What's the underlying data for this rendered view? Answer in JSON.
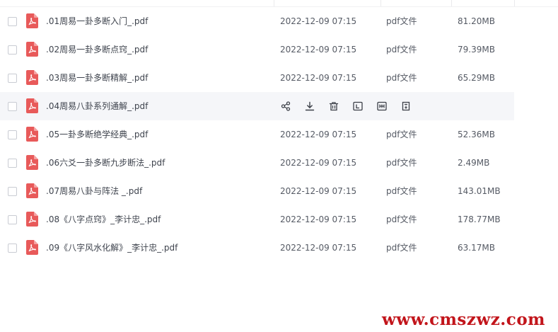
{
  "files": [
    {
      "name": ".01周易一卦多断入门_.pdf",
      "date": "2022-12-09 07:15",
      "type": "pdf文件",
      "size": "81.20MB"
    },
    {
      "name": ".02周易一卦多断点窍_.pdf",
      "date": "2022-12-09 07:15",
      "type": "pdf文件",
      "size": "79.39MB"
    },
    {
      "name": ".03周易一卦多断精解_.pdf",
      "date": "2022-12-09 07:15",
      "type": "pdf文件",
      "size": "65.29MB"
    },
    {
      "name": ".04周易八卦系列通解_.pdf",
      "date": "",
      "type": "",
      "size": "",
      "hovered": true
    },
    {
      "name": ".05一卦多断绝学经典_.pdf",
      "date": "2022-12-09 07:15",
      "type": "pdf文件",
      "size": "52.36MB"
    },
    {
      "name": ".06六爻一卦多断九步断法_.pdf",
      "date": "2022-12-09 07:15",
      "type": "pdf文件",
      "size": "2.49MB"
    },
    {
      "name": ".07周易八卦与阵法 _.pdf",
      "date": "2022-12-09 07:15",
      "type": "pdf文件",
      "size": "143.01MB"
    },
    {
      "name": ".08《八字点窍》_李计忠_.pdf",
      "date": "2022-12-09 07:15",
      "type": "pdf文件",
      "size": "178.77MB"
    },
    {
      "name": ".09《八字风水化解》_李计忠_.pdf",
      "date": "2022-12-09 07:15",
      "type": "pdf文件",
      "size": "63.17MB"
    }
  ],
  "hover_actions": [
    {
      "name": "share-icon"
    },
    {
      "name": "download-icon"
    },
    {
      "name": "delete-icon"
    },
    {
      "name": "rename-icon"
    },
    {
      "name": "copy-icon"
    },
    {
      "name": "move-icon"
    }
  ],
  "watermark": "www.cmszwz.com",
  "colors": {
    "pdf_icon": "#e85a5a",
    "hover_row": "#f5f6f9",
    "watermark": "#c2151b"
  }
}
